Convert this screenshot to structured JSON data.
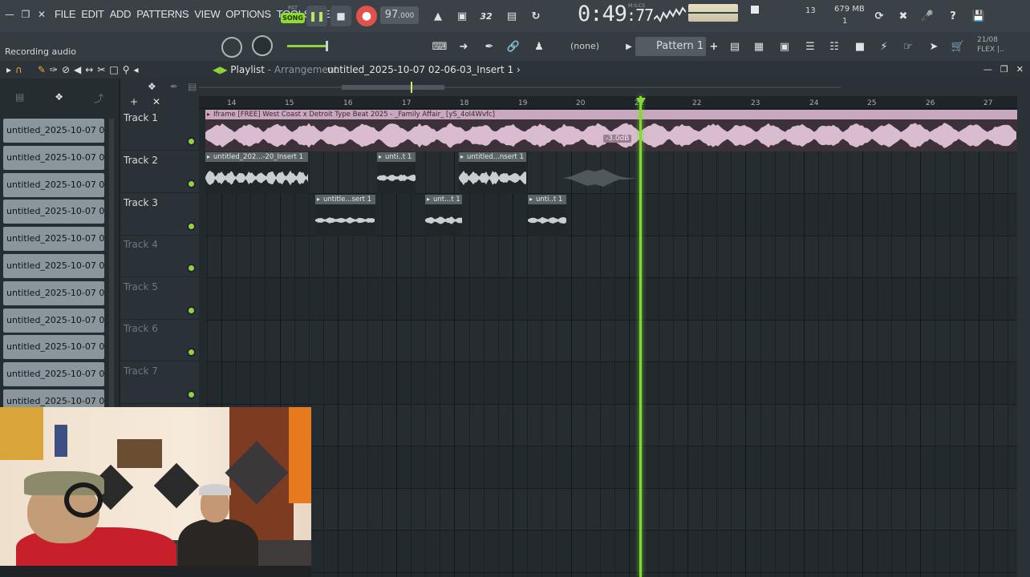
{
  "menu": [
    "FILE",
    "EDIT",
    "ADD",
    "PATTERNS",
    "VIEW",
    "OPTIONS",
    "TOOLS",
    "HELP"
  ],
  "transport": {
    "pat_label": "PAT",
    "song_label": "SONG",
    "tempo_int": "97",
    "tempo_dec": ".000",
    "time_main": "0:49",
    "time_sub": ":77",
    "time_unit": "M:S:CS"
  },
  "status": {
    "voices": "13",
    "memory": "679 MB",
    "cpu_line2": "1"
  },
  "hint_text": "Recording audio",
  "channel_selector": "(none)",
  "pattern": "Pattern 1",
  "flex_info": {
    "line1": "21/08",
    "line2": "FLEX |.."
  },
  "playlist": {
    "title": "Playlist",
    "separator": " - ",
    "subtitle": "Arrangement",
    "path": "untitled_2025-10-07 02-06-03_Insert 1",
    "path_arrow": "›"
  },
  "browser_items": [
    "untitled_2025-10-07 01-...",
    "untitled_2025-10-07 02-...",
    "untitled_2025-10-07 02-...",
    "untitled_2025-10-07 02-...",
    "untitled_2025-10-07 02-...",
    "untitled_2025-10-07 02-...",
    "untitled_2025-10-07 02-...",
    "untitled_2025-10-07 02-...",
    "untitled_2025-10-07 02-...",
    "untitled_2025-10-07 02-...",
    "untitled_2025-10-07 02-..."
  ],
  "tracks": [
    "Track 1",
    "Track 2",
    "Track 3",
    "Track 4",
    "Track 5",
    "Track 6",
    "Track 7"
  ],
  "ruler_bars": [
    "14",
    "15",
    "16",
    "17",
    "18",
    "19",
    "20",
    "21",
    "22",
    "23",
    "24",
    "25",
    "26",
    "27"
  ],
  "clips": {
    "t1_main": "Iframe [FREE] West Coast x Detroit Type Beat 2025 - _Family Affair_ [yS_4oI4Wvfc]",
    "t1_gain": "-3.0dB",
    "t2_a": "untitled_202...-20_Insert 1",
    "t2_b": "unti..t 1",
    "t2_c": "untitled...nsert 1",
    "t3_a": "untitle...sert 1",
    "t3_b": "unt...t 1",
    "t3_c": "unti..t 1"
  },
  "colors": {
    "accent_green": "#8ed43a",
    "main_clip": "#c9a7bf",
    "record": "#e1524b"
  }
}
